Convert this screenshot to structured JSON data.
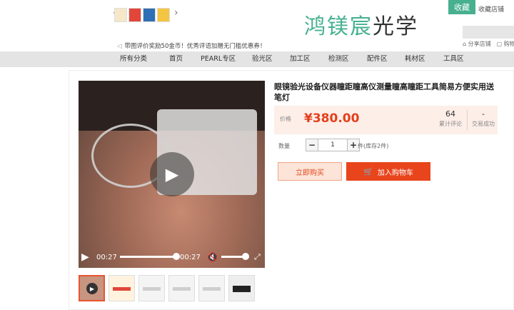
{
  "header": {
    "brand_part1": "鸿镁宸",
    "brand_part2": "光学",
    "fav_label": "收藏",
    "fav_text": "收藏店铺",
    "share_label": "分享店铺",
    "cart_label": "购物车",
    "notice": "带图评价奖励50金币！优秀评语加赠无门槛优惠券！"
  },
  "nav": {
    "items": [
      "所有分类",
      "首页",
      "PEARL专区",
      "验光区",
      "加工区",
      "检测区",
      "配件区",
      "耗材区",
      "工具区"
    ]
  },
  "product": {
    "title": "眼镜验光设备仪器瞳距瞳高仪测量瞳高瞳距工具简易方便实用送笔灯",
    "price_label": "价格",
    "price": "¥380.00",
    "reviews_count": "64",
    "reviews_label": "累计评论",
    "sales_count": "-",
    "sales_label": "交易成功",
    "qty_label": "数量",
    "qty_value": "1",
    "stock_text": "件(库存2件)",
    "buy_label": "立即购买",
    "cart_label": "加入购物车"
  },
  "video": {
    "current_time": "00:27",
    "duration": "00:27",
    "progress": 1.0,
    "volume": 1.0
  },
  "colors": {
    "brand_green": "#47b08f",
    "price_red": "#e43f1c",
    "cart_orange": "#e8451d"
  },
  "icons": {
    "play": "play-icon",
    "mute": "volume-mute-icon",
    "fullscreen": "fullscreen-icon",
    "cart": "cart-icon"
  }
}
